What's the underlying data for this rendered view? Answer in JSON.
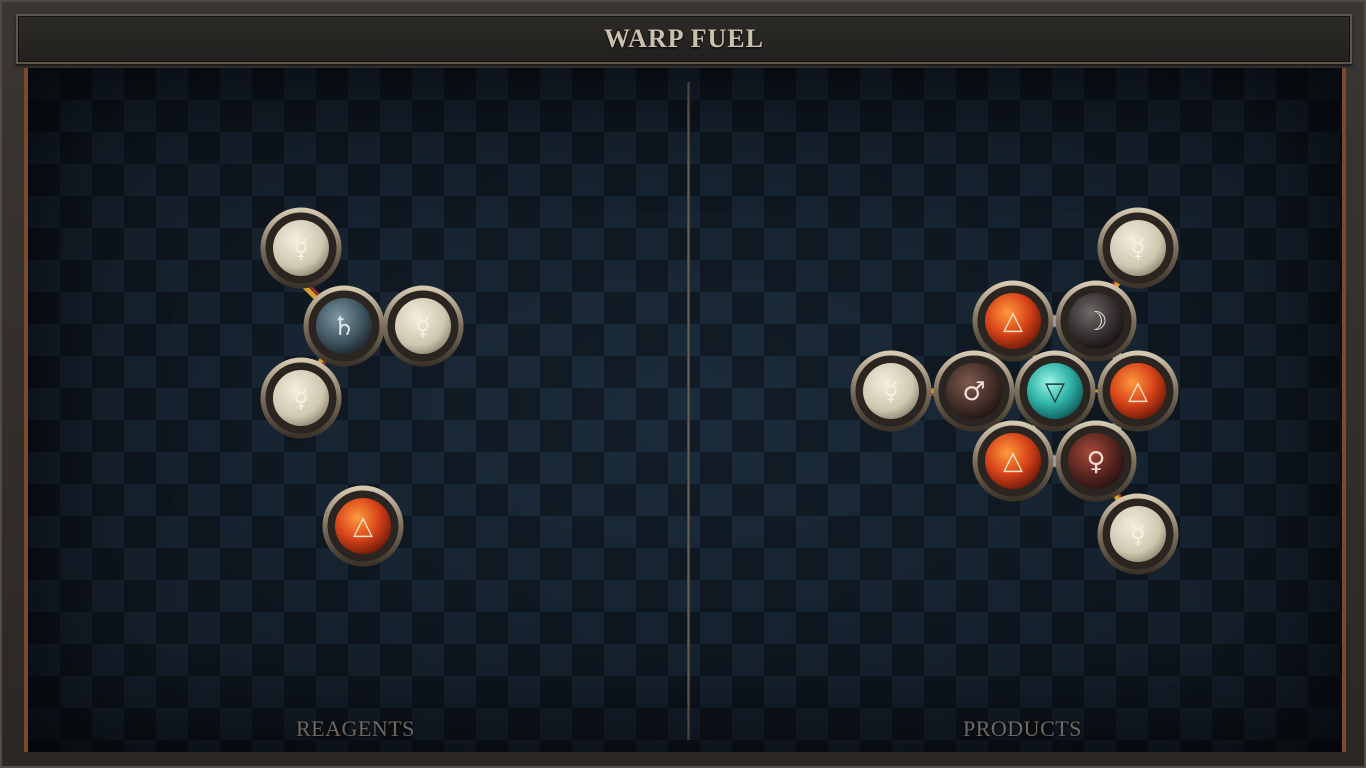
{
  "title": "WARP FUEL",
  "panels": {
    "left_label": "REAGENTS",
    "right_label": "PRODUCTS"
  },
  "atoms": {
    "quicksilver": {
      "glyph": "☿",
      "color": "#d8d1bd"
    },
    "lead": {
      "glyph": "♄",
      "color": "#4d646f"
    },
    "fire": {
      "glyph": "△",
      "color": "#e2541f"
    },
    "water": {
      "glyph": "▽",
      "color": "#3fc0b6"
    },
    "iron": {
      "glyph": "♂",
      "color": "#4a3530"
    },
    "silver": {
      "glyph": "☽",
      "color": "#3a3533"
    },
    "copper": {
      "glyph": "♀",
      "color": "#5a2a24"
    }
  },
  "reagents": [
    {
      "id": "r1",
      "atoms": [
        "quicksilver",
        "quicksilver",
        "lead",
        "quicksilver"
      ]
    },
    {
      "id": "r2",
      "atoms": [
        "fire"
      ]
    }
  ],
  "products": [
    {
      "id": "p1",
      "atoms": [
        "quicksilver",
        "fire",
        "silver",
        "iron",
        "water",
        "fire",
        "fire",
        "copper",
        "quicksilver",
        "quicksilver"
      ]
    }
  ]
}
